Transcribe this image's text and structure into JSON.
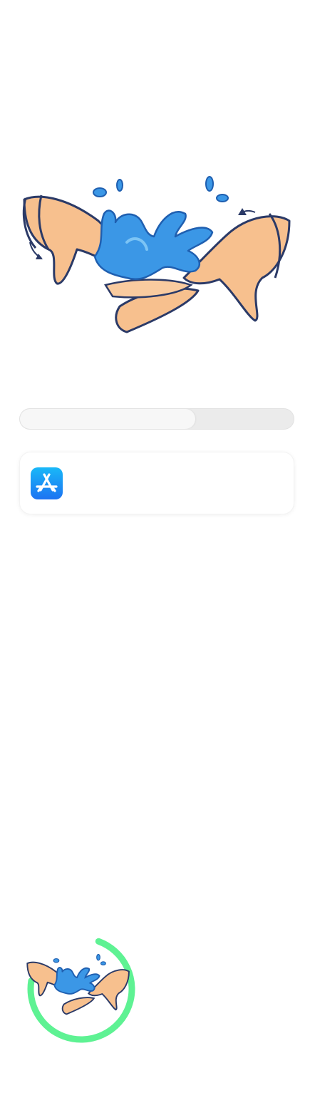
{
  "icons": {
    "hero": "hands-washing-water-splash-icon",
    "app": "app-store-icon",
    "timer": "hands-washing-water-splash-icon"
  },
  "progress": {
    "fraction": 0.64
  },
  "app_card": {
    "name": ""
  },
  "timer": {
    "fraction": 0.72,
    "ring_color": "#5ef293"
  },
  "colors": {
    "water": "#3b97e6",
    "skin": "#f7c08e",
    "outline": "#2b3a67",
    "app_icon_top": "#19b8f8",
    "app_icon_bottom": "#1d73f2"
  }
}
